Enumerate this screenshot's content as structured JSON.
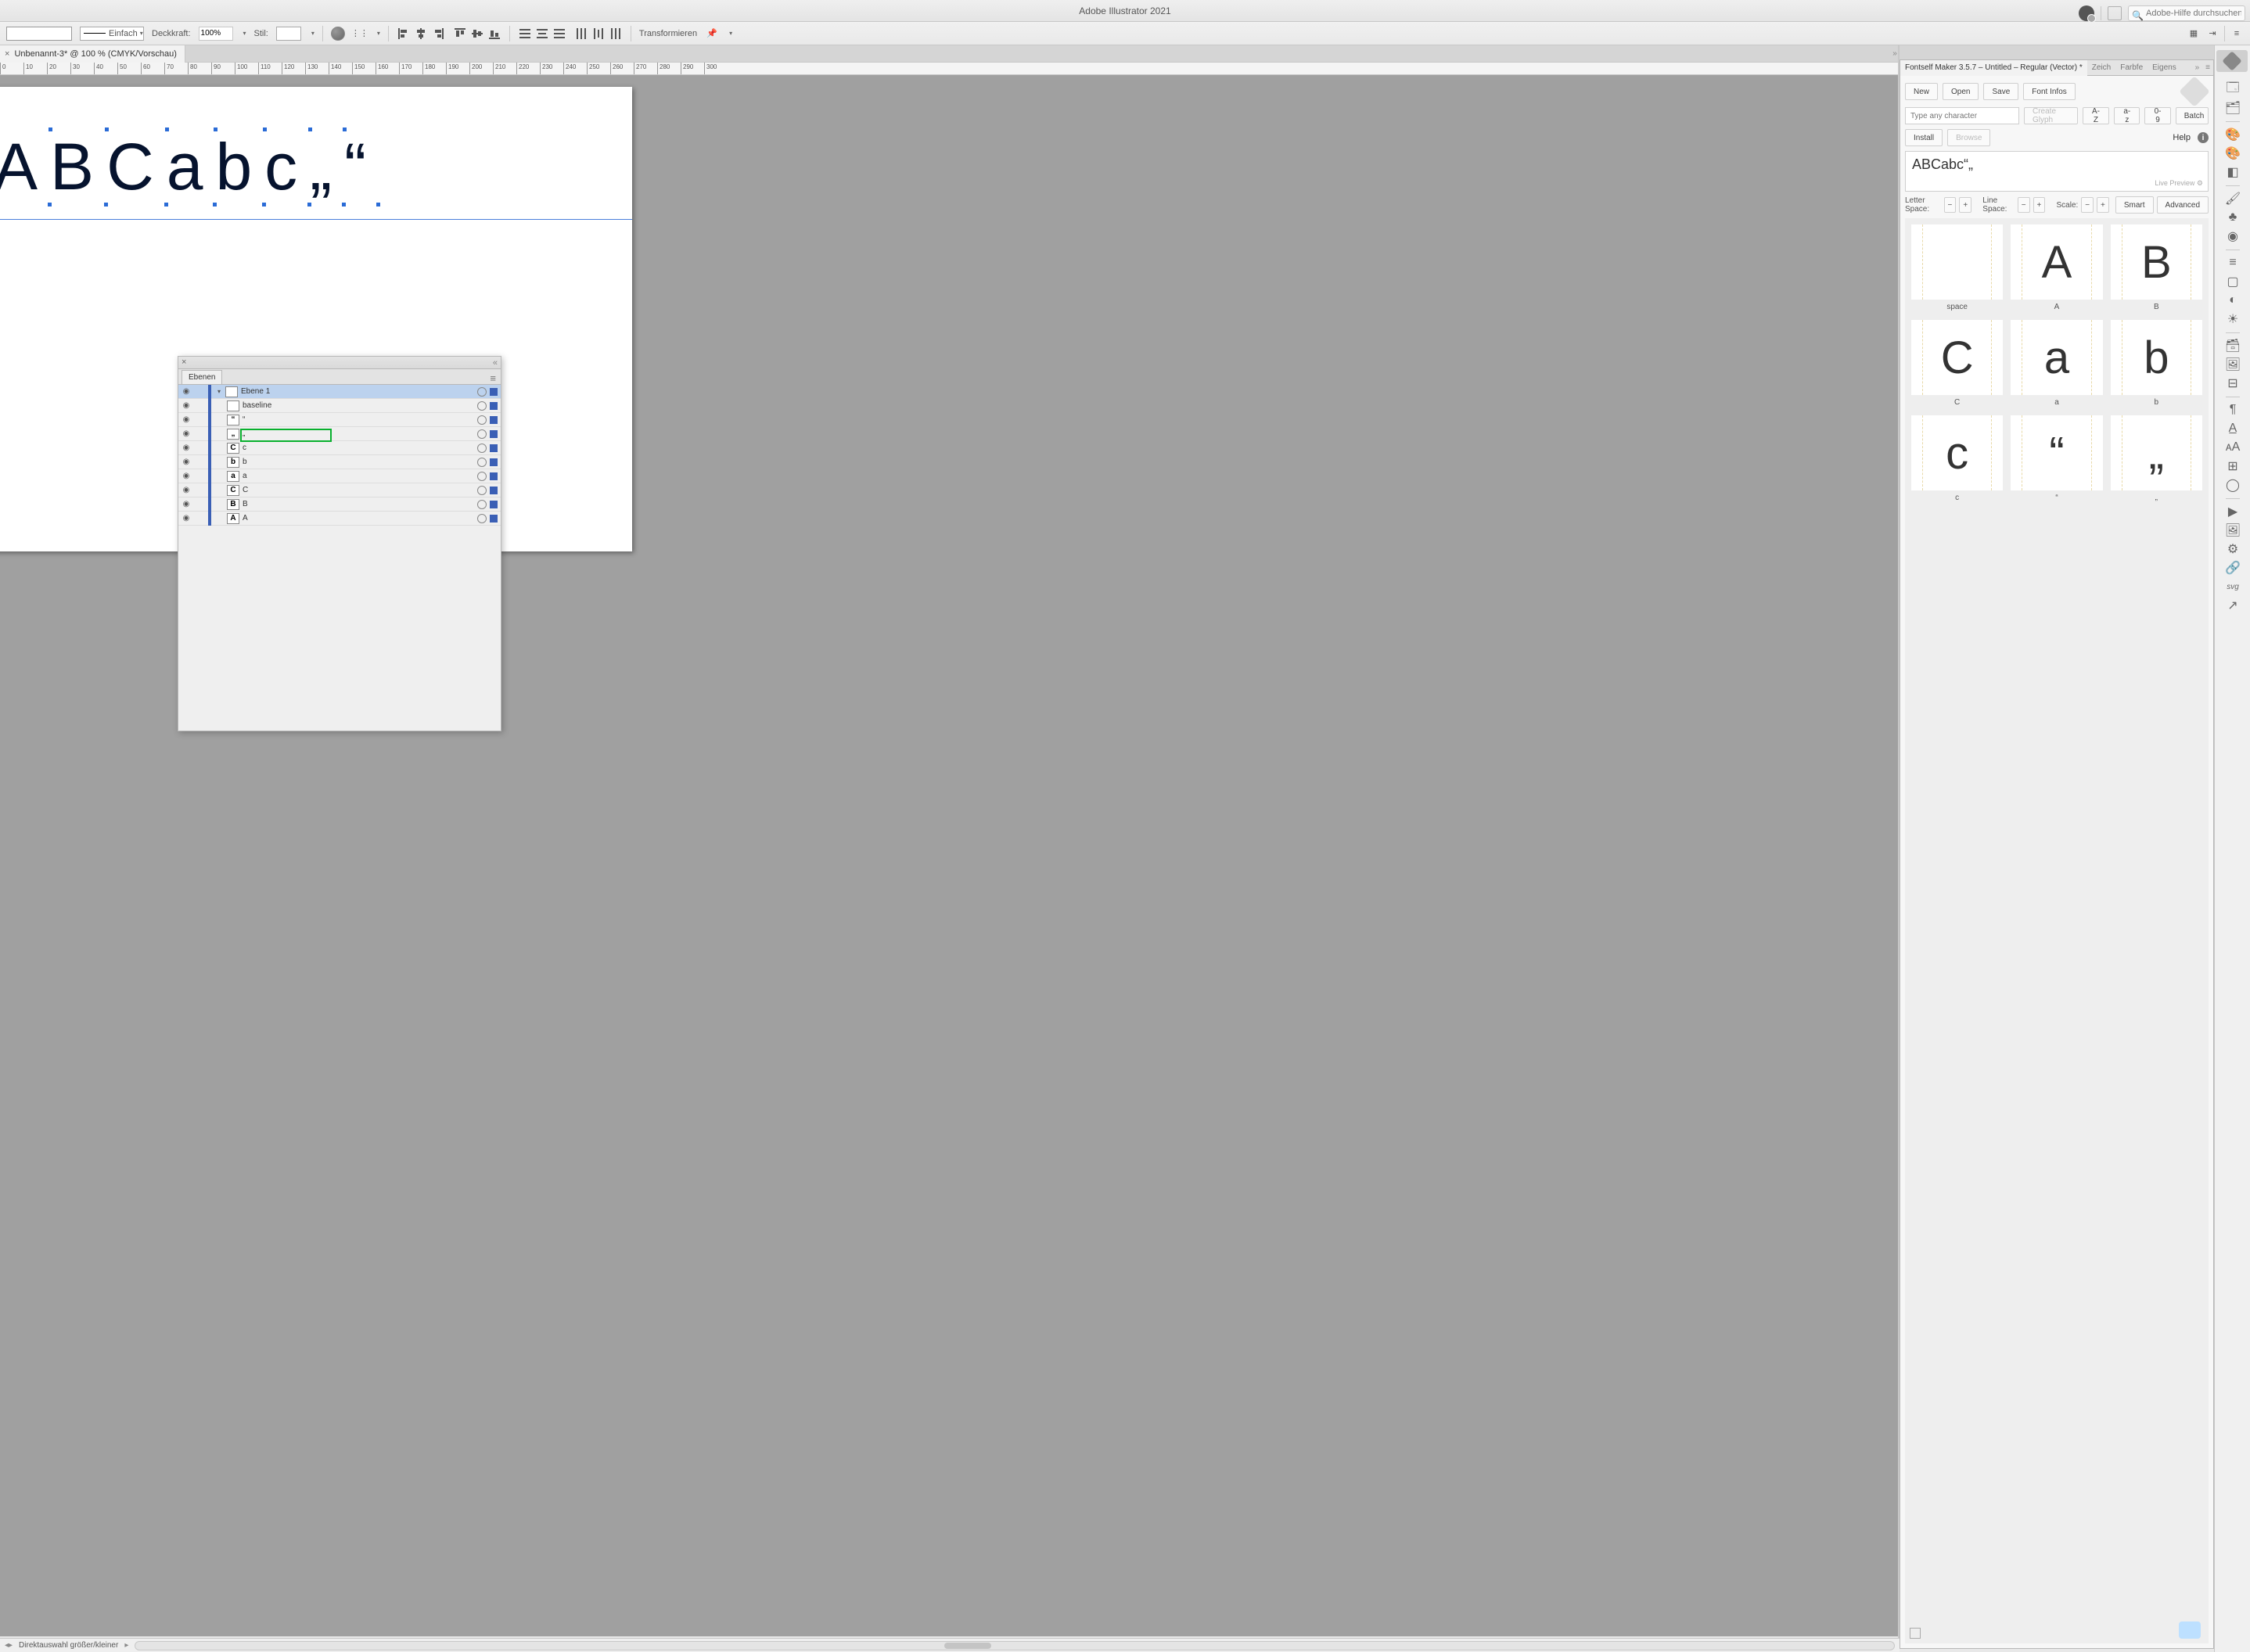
{
  "app_title": "Adobe Illustrator 2021",
  "search_placeholder": "Adobe-Hilfe durchsuchen",
  "options_bar": {
    "stroke_label": "Einfach",
    "opacity_label": "Deckkraft:",
    "opacity_value": "100%",
    "style_label": "Stil:",
    "transform_label": "Transformieren"
  },
  "document_tab": "Unbenannt-3* @ 100 % (CMYK/Vorschau)",
  "ruler_ticks": [
    "0",
    "10",
    "20",
    "30",
    "40",
    "50",
    "60",
    "70",
    "80",
    "90",
    "100",
    "110",
    "120",
    "130",
    "140",
    "150",
    "160",
    "170",
    "180",
    "190",
    "200",
    "210",
    "220",
    "230",
    "240",
    "250",
    "260",
    "270",
    "280",
    "290",
    "300"
  ],
  "canvas_text": [
    "A",
    "B",
    "C",
    "a",
    "b",
    "c",
    "„",
    "“"
  ],
  "layers_panel": {
    "title": "Ebenen",
    "top_layer": "Ebene 1",
    "items": [
      {
        "thumb": "",
        "name": "baseline",
        "highlight": true
      },
      {
        "thumb": "“",
        "name": "“"
      },
      {
        "thumb": "„",
        "name": "„"
      },
      {
        "thumb": "C",
        "name": "c"
      },
      {
        "thumb": "b",
        "name": "b"
      },
      {
        "thumb": "a",
        "name": "a"
      },
      {
        "thumb": "C",
        "name": "C"
      },
      {
        "thumb": "B",
        "name": "B"
      },
      {
        "thumb": "A",
        "name": "A"
      }
    ]
  },
  "fontself": {
    "tab_label": "Fontself Maker 3.5.7 – Untitled – Regular (Vector) *",
    "other_tabs": [
      "Zeich",
      "Farbfe",
      "Eigens"
    ],
    "buttons": {
      "new": "New",
      "open": "Open",
      "save": "Save",
      "infos": "Font Infos",
      "create": "Create Glyph",
      "install": "Install",
      "browse": "Browse",
      "smart": "Smart",
      "advanced": "Advanced"
    },
    "ranges": {
      "az_upper": "A-Z",
      "az_lower": "a-z",
      "digits": "0-9",
      "batch": "Batch"
    },
    "char_placeholder": "Type any character",
    "help": "Help",
    "preview_text": "ABCabc“„",
    "live_preview": "Live Preview",
    "labels": {
      "letter": "Letter Space:",
      "line": "Line Space:",
      "scale": "Scale:"
    },
    "glyphs": [
      {
        "g": "",
        "l": "space"
      },
      {
        "g": "A",
        "l": "A"
      },
      {
        "g": "B",
        "l": "B"
      },
      {
        "g": "C",
        "l": "C"
      },
      {
        "g": "a",
        "l": "a"
      },
      {
        "g": "b",
        "l": "b"
      },
      {
        "g": "c",
        "l": "c"
      },
      {
        "g": "“",
        "l": "“"
      },
      {
        "g": "„",
        "l": "„"
      }
    ]
  },
  "status_bar": {
    "tool": "Direktauswahl größer/kleiner"
  }
}
